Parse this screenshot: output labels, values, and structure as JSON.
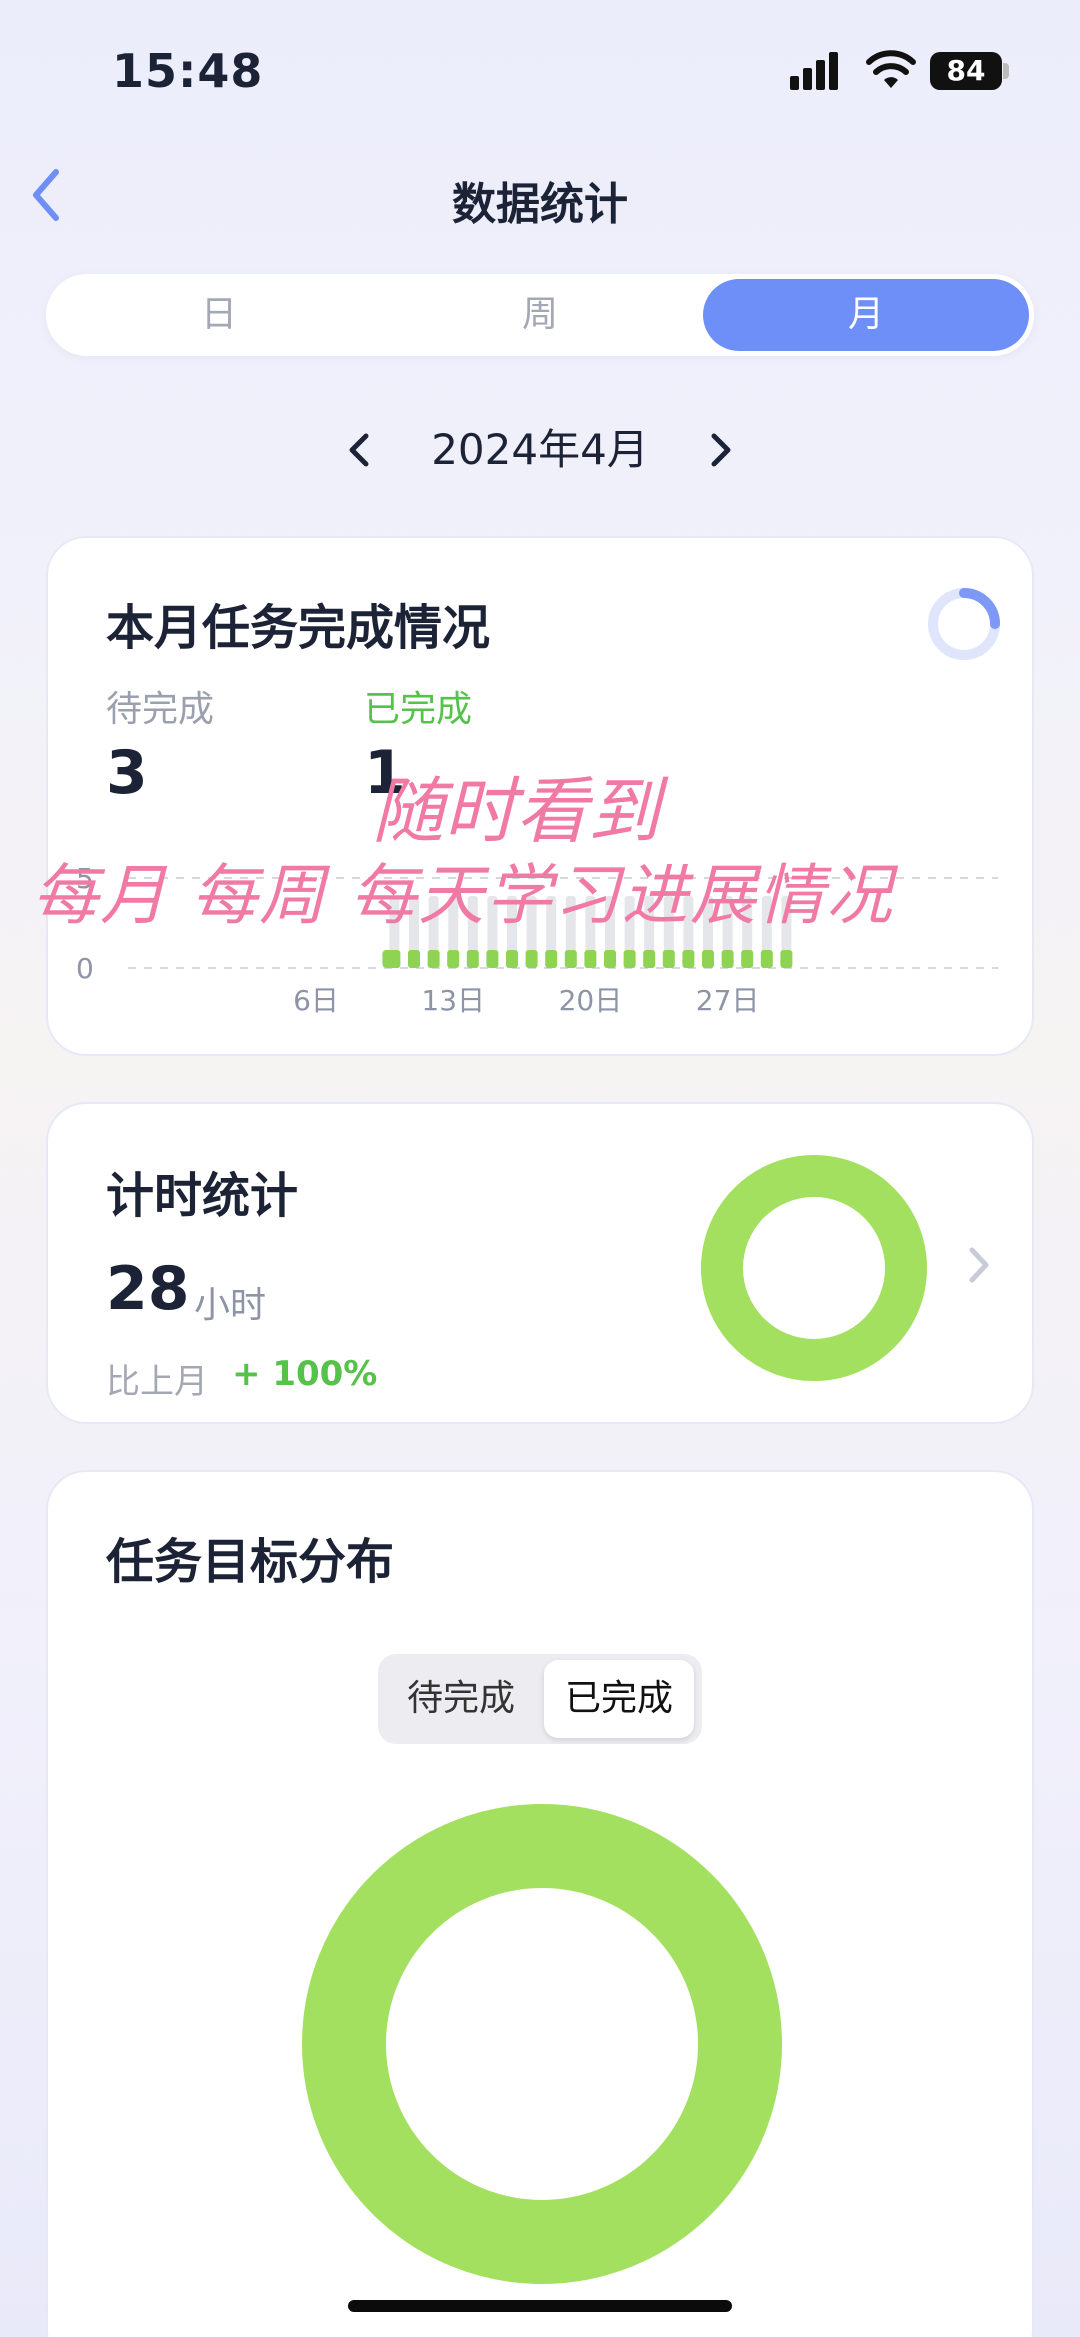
{
  "status_bar": {
    "time": "15:48",
    "battery": "84"
  },
  "nav": {
    "title": "数据统计"
  },
  "segments": [
    {
      "label": "日",
      "active": false
    },
    {
      "label": "周",
      "active": false
    },
    {
      "label": "月",
      "active": true
    }
  ],
  "date_selector": {
    "label": "2024年4月"
  },
  "task_card": {
    "title": "本月任务完成情况",
    "pending_label": "待完成",
    "pending_value": "3",
    "done_label": "已完成",
    "done_value": "1",
    "progress_fraction": 0.25
  },
  "chart_data": {
    "type": "bar",
    "ylim": [
      0,
      5
    ],
    "y_ticks": [
      "0",
      "5"
    ],
    "x_ticks": [
      "6日",
      "13日",
      "20日",
      "27日"
    ],
    "categories": [
      "1",
      "2",
      "3",
      "4",
      "5",
      "6",
      "7",
      "8",
      "9",
      "10",
      "11",
      "12",
      "13",
      "14",
      "15",
      "16",
      "17",
      "18",
      "19",
      "20",
      "21",
      "22",
      "23",
      "24",
      "25",
      "26",
      "27",
      "28",
      "29",
      "30"
    ],
    "series": [
      {
        "name": "待完成",
        "values": [
          0,
          0,
          0,
          0,
          0,
          0,
          0,
          0,
          0,
          3,
          3,
          3,
          3,
          3,
          3,
          3,
          3,
          3,
          3,
          3,
          3,
          3,
          3,
          3,
          3,
          3,
          3,
          3,
          3,
          3
        ]
      },
      {
        "name": "已完成",
        "values": [
          0,
          0,
          0,
          0,
          0,
          0,
          0,
          0,
          0,
          1,
          1,
          1,
          1,
          1,
          1,
          1,
          1,
          1,
          1,
          1,
          1,
          1,
          1,
          1,
          1,
          1,
          1,
          1,
          1,
          1
        ]
      }
    ],
    "colors": {
      "pending": "#e5e6ea",
      "done": "#8ed352",
      "accent": "#a9e566"
    }
  },
  "timer_card": {
    "title": "计时统计",
    "hours_value": "28",
    "hours_unit": "小时",
    "compare_label": "比上月",
    "compare_value": "+ 100%"
  },
  "distribution_card": {
    "title": "任务目标分布",
    "toggle": [
      {
        "label": "待完成",
        "active": false
      },
      {
        "label": "已完成",
        "active": true
      }
    ]
  },
  "overlay": {
    "line1": "随时看到",
    "line2": "每月 每周 每天学习进展情况"
  },
  "colors": {
    "primary": "#6e8ff7",
    "green": "#a4e060",
    "green_text": "#55c24a",
    "pink_overlay": "#f07aa4"
  }
}
